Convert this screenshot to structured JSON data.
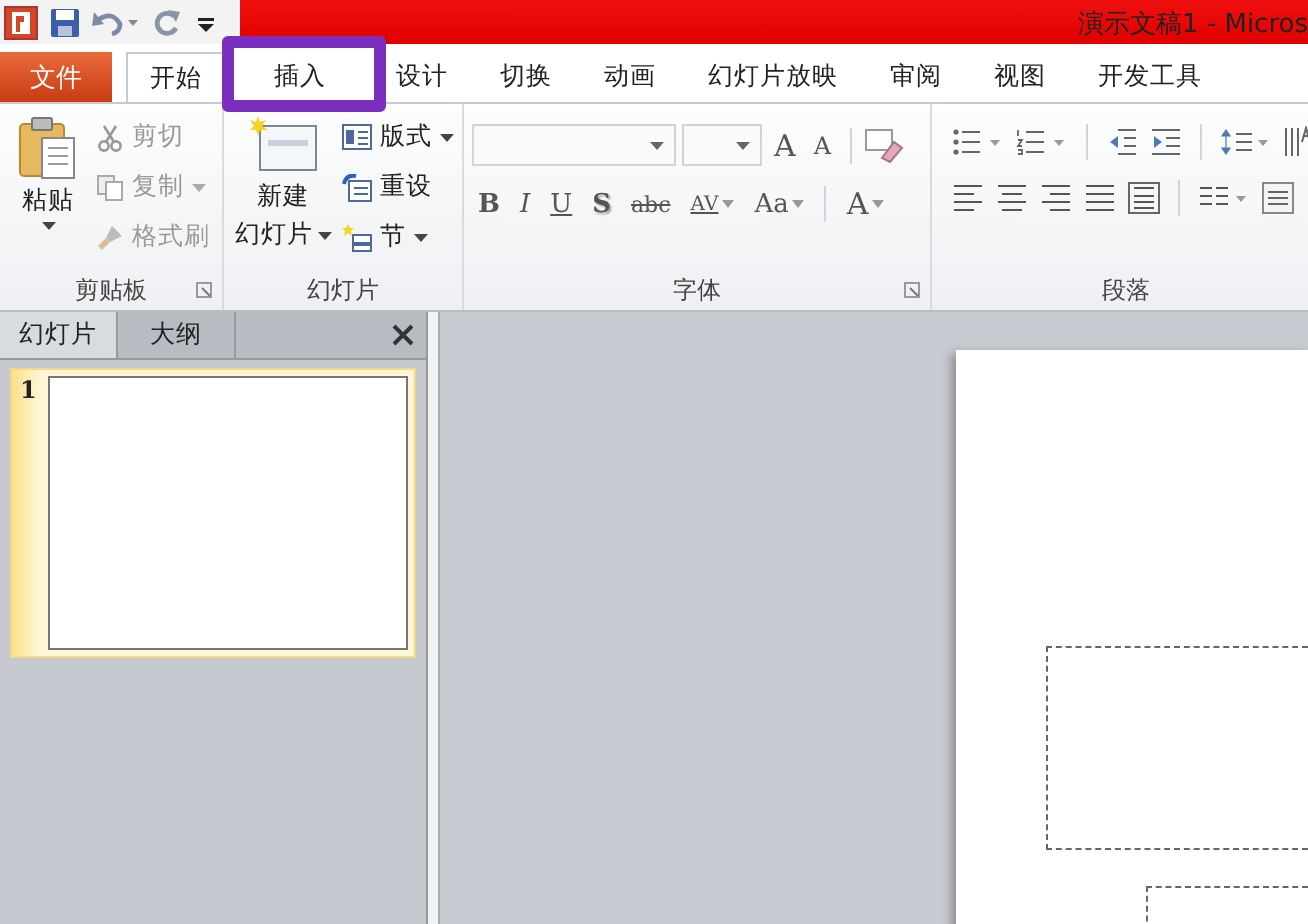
{
  "window": {
    "title": "演示文稿1 - Micros"
  },
  "file_tab": "文件",
  "tabs": [
    {
      "label": "开始",
      "selected": true,
      "highlighted": false
    },
    {
      "label": "插入",
      "selected": false,
      "highlighted": true
    },
    {
      "label": "设计",
      "selected": false,
      "highlighted": false
    },
    {
      "label": "切换",
      "selected": false,
      "highlighted": false
    },
    {
      "label": "动画",
      "selected": false,
      "highlighted": false
    },
    {
      "label": "幻灯片放映",
      "selected": false,
      "highlighted": false
    },
    {
      "label": "审阅",
      "selected": false,
      "highlighted": false
    },
    {
      "label": "视图",
      "selected": false,
      "highlighted": false
    },
    {
      "label": "开发工具",
      "selected": false,
      "highlighted": false
    }
  ],
  "clipboard": {
    "label": "剪贴板",
    "paste": "粘贴",
    "items": [
      {
        "label": "剪切",
        "disabled": true,
        "dropdown": false
      },
      {
        "label": "复制",
        "disabled": true,
        "dropdown": true
      },
      {
        "label": "格式刷",
        "disabled": true,
        "dropdown": false
      }
    ]
  },
  "slides_group": {
    "label": "幻灯片",
    "new_slide": [
      "新建",
      "幻灯片"
    ],
    "items": [
      {
        "label": "版式",
        "dropdown": true
      },
      {
        "label": "重设",
        "dropdown": false
      },
      {
        "label": "节",
        "dropdown": true
      }
    ]
  },
  "font": {
    "label": "字体",
    "size_buttons": [
      {
        "label": "A",
        "kind": "grow"
      },
      {
        "label": "A",
        "kind": "shrink"
      }
    ],
    "buttons": [
      {
        "label": "B",
        "kind": "bold",
        "dropdown": false
      },
      {
        "label": "I",
        "kind": "italic",
        "dropdown": false
      },
      {
        "label": "U",
        "kind": "underline",
        "dropdown": false
      },
      {
        "label": "S",
        "kind": "shadow",
        "dropdown": false
      },
      {
        "label": "abc",
        "kind": "strike",
        "dropdown": false
      },
      {
        "label": "AV",
        "kind": "spacing",
        "dropdown": true
      },
      {
        "label": "Aa",
        "kind": "case",
        "dropdown": true
      },
      {
        "label": "A",
        "kind": "color",
        "dropdown": true
      }
    ]
  },
  "paragraph": {
    "label": "段落"
  },
  "side_panel": {
    "tabs": [
      {
        "label": "幻灯片",
        "selected": true
      },
      {
        "label": "大纲",
        "selected": false
      }
    ],
    "slides": [
      {
        "number": "1",
        "selected": true
      }
    ]
  }
}
